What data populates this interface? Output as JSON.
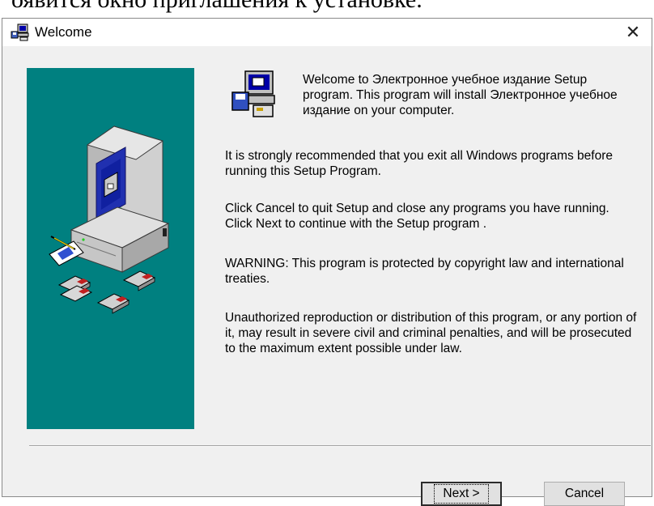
{
  "document": {
    "heading_fragment": "оявится окно приглашения к установке."
  },
  "window": {
    "title": "Welcome",
    "close_glyph": "✕",
    "title_icon": "setup-computer-icon"
  },
  "content": {
    "welcome_text": "Welcome to Электронное учебное издание Setup program. This program will install Электронное учебное издание on your computer.",
    "recommend_text": "It is strongly recommended that you exit all Windows programs before running this Setup Program.",
    "cancel_text": "Click Cancel to quit Setup and close any programs you have running.  Click Next to continue with the Setup program .",
    "warning_text": "WARNING: This program is protected by copyright law and international treaties.",
    "unauthorized_text": "Unauthorized reproduction or distribution of this program, or any portion of it, may result in severe civil and criminal penalties, and will be prosecuted to the maximum extent possible under law."
  },
  "buttons": {
    "next_label": "Next >",
    "cancel_label": "Cancel"
  },
  "colors": {
    "panel": "#008080",
    "window_bg": "#f0f0f0"
  }
}
